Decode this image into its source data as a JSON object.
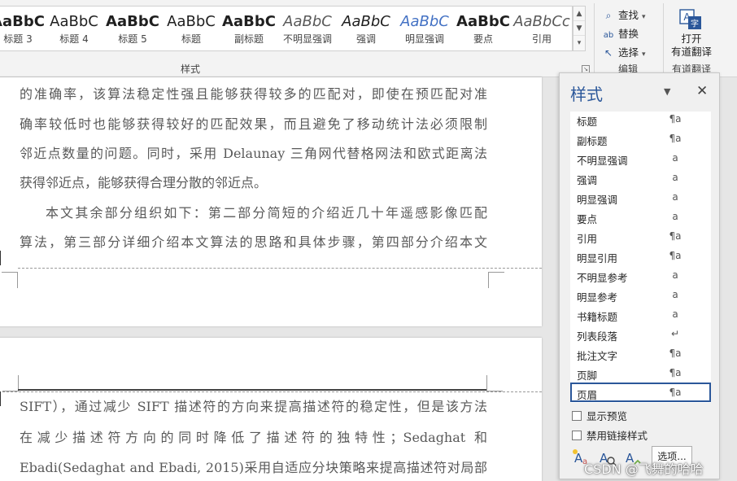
{
  "ribbon": {
    "gallery": [
      {
        "preview": "AaBbC",
        "name": "标题 3",
        "weight": "bold",
        "italic": false,
        "color": "#1f1f1f"
      },
      {
        "preview": "AaBbC",
        "name": "标题 4",
        "weight": "normal",
        "italic": false,
        "color": "#1f1f1f"
      },
      {
        "preview": "AaBbC",
        "name": "标题 5",
        "weight": "bold",
        "italic": false,
        "color": "#1f1f1f"
      },
      {
        "preview": "AaBbC",
        "name": "标题",
        "weight": "normal",
        "italic": false,
        "color": "#1f1f1f"
      },
      {
        "preview": "AaBbC",
        "name": "副标题",
        "weight": "bold",
        "italic": false,
        "color": "#1f1f1f"
      },
      {
        "preview": "AaBbC",
        "name": "不明显强调",
        "weight": "normal",
        "italic": true,
        "color": "#595959"
      },
      {
        "preview": "AaBbC",
        "name": "强调",
        "weight": "normal",
        "italic": true,
        "color": "#1f1f1f"
      },
      {
        "preview": "AaBbC",
        "name": "明显强调",
        "weight": "normal",
        "italic": true,
        "color": "#4472c4"
      },
      {
        "preview": "AaBbC",
        "name": "要点",
        "weight": "bold",
        "italic": false,
        "color": "#1f1f1f"
      },
      {
        "preview": "AaBbCc",
        "name": "引用",
        "weight": "normal",
        "italic": true,
        "color": "#595959"
      }
    ],
    "styles_group_label": "样式",
    "editing": {
      "find": "查找",
      "replace": "替换",
      "select": "选择",
      "group_label": "编辑"
    },
    "translate": {
      "line1": "打开",
      "line2": "有道翻译",
      "group_label": "有道翻译"
    }
  },
  "document": {
    "page1_lines": [
      "的准确率，该算法稳定性强且能够获得较多的匹配对，即使在预匹配对准",
      "确率较低时也能够获得较好的匹配效果，而且避免了移动统计法必须限制",
      "邻近点数量的问题。同时，采用 Delaunay 三角网代替格网法和欧式距离法",
      "获得邻近点，能够获得合理分散的邻近点。",
      "本文其余部分组织如下：第二部分简短的介绍近几十年遥感影像匹配",
      "算法，第三部分详细介绍本文算法的思路和具体步骤，第四部分介绍本文"
    ],
    "page2_lines": [
      "SIFT），通过减少 SIFT 描述符的方向来提高描述符的稳定性，但是该方法",
      "在减少描述符方向的同时降低了描述符的独特性；Sedaghat 和",
      "Ebadi(Sedaghat and Ebadi, 2015)采用自适应分块策略来提高描述符对局部"
    ]
  },
  "styles_pane": {
    "title": "样式",
    "items": [
      {
        "name": "标题",
        "type": "¶a"
      },
      {
        "name": "副标题",
        "type": "¶a"
      },
      {
        "name": "不明显强调",
        "type": "a"
      },
      {
        "name": "强调",
        "type": "a"
      },
      {
        "name": "明显强调",
        "type": "a"
      },
      {
        "name": "要点",
        "type": "a"
      },
      {
        "name": "引用",
        "type": "¶a"
      },
      {
        "name": "明显引用",
        "type": "¶a"
      },
      {
        "name": "不明显参考",
        "type": "a"
      },
      {
        "name": "明显参考",
        "type": "a"
      },
      {
        "name": "书籍标题",
        "type": "a"
      },
      {
        "name": "列表段落",
        "type": "↵"
      },
      {
        "name": "批注文字",
        "type": "¶a"
      },
      {
        "name": "页脚",
        "type": "¶a"
      },
      {
        "name": "页眉",
        "type": "¶a"
      }
    ],
    "selected": "页眉",
    "show_preview": "显示预览",
    "disable_linked": "禁用链接样式",
    "options": "选项..."
  },
  "watermark": "CSDN @飞舞的哈哈"
}
